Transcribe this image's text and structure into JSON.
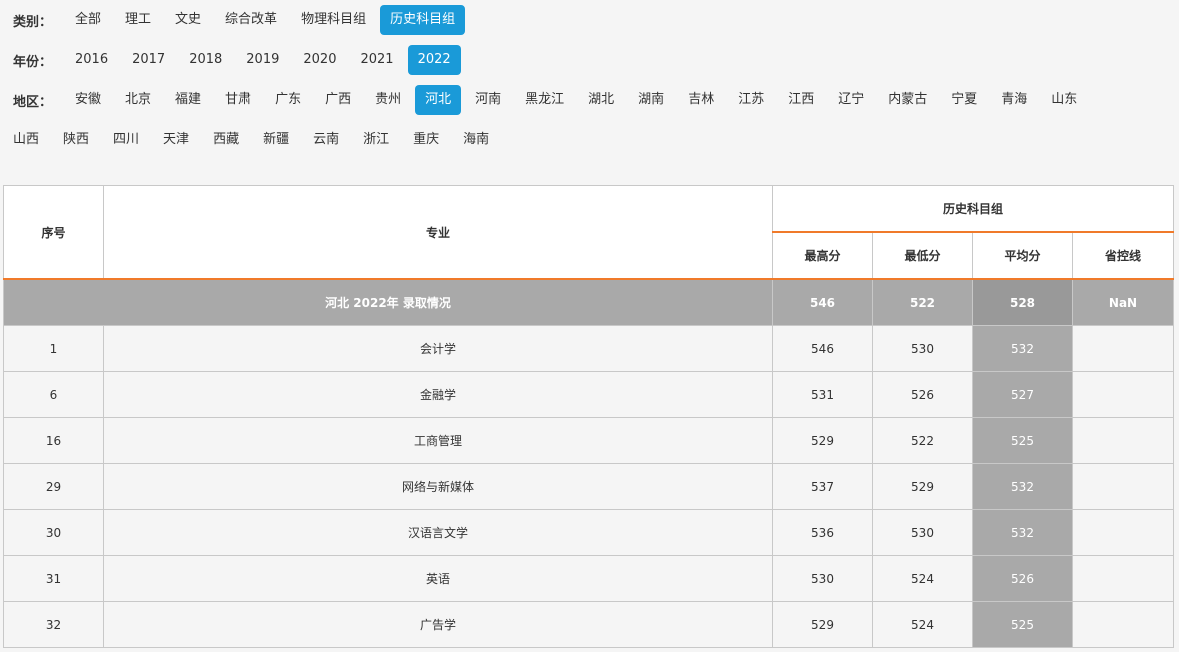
{
  "filters": {
    "category": {
      "label": "类别：",
      "options": [
        "全部",
        "理工",
        "文史",
        "综合改革",
        "物理科目组",
        "历史科目组"
      ],
      "selected": "历史科目组"
    },
    "year": {
      "label": "年份：",
      "options": [
        "2016",
        "2017",
        "2018",
        "2019",
        "2020",
        "2021",
        "2022"
      ],
      "selected": "2022"
    },
    "region": {
      "label": "地区：",
      "options_row1": [
        "安徽",
        "北京",
        "福建",
        "甘肃",
        "广东",
        "广西",
        "贵州",
        "河北",
        "河南",
        "黑龙江",
        "湖北",
        "湖南",
        "吉林",
        "江苏",
        "江西",
        "辽宁",
        "内蒙古",
        "宁夏",
        "青海",
        "山东"
      ],
      "options_row2": [
        "山西",
        "陕西",
        "四川",
        "天津",
        "西藏",
        "新疆",
        "云南",
        "浙江",
        "重庆",
        "海南"
      ],
      "selected": "河北"
    }
  },
  "colors": {
    "accent": "#1a9ad8",
    "header_underline": "#f07a2a",
    "summary_bg": "#a9a9a9"
  },
  "table": {
    "headers": {
      "index": "序号",
      "major": "专业",
      "group": "历史科目组",
      "max": "最高分",
      "min": "最低分",
      "avg": "平均分",
      "control": "省控线"
    },
    "summary": {
      "title": "河北 2022年 录取情况",
      "max": "546",
      "min": "522",
      "avg": "528",
      "control": "NaN"
    },
    "rows": [
      {
        "index": "1",
        "major": "会计学",
        "max": "546",
        "min": "530",
        "avg": "532",
        "control": ""
      },
      {
        "index": "6",
        "major": "金融学",
        "max": "531",
        "min": "526",
        "avg": "527",
        "control": ""
      },
      {
        "index": "16",
        "major": "工商管理",
        "max": "529",
        "min": "522",
        "avg": "525",
        "control": ""
      },
      {
        "index": "29",
        "major": "网络与新媒体",
        "max": "537",
        "min": "529",
        "avg": "532",
        "control": ""
      },
      {
        "index": "30",
        "major": "汉语言文学",
        "max": "536",
        "min": "530",
        "avg": "532",
        "control": ""
      },
      {
        "index": "31",
        "major": "英语",
        "max": "530",
        "min": "524",
        "avg": "526",
        "control": ""
      },
      {
        "index": "32",
        "major": "广告学",
        "max": "529",
        "min": "524",
        "avg": "525",
        "control": ""
      }
    ]
  }
}
